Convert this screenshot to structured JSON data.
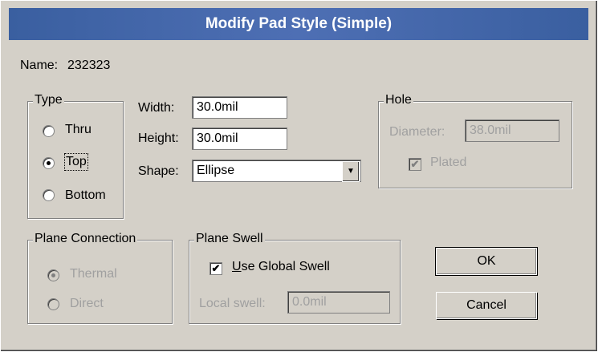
{
  "window": {
    "title": "Modify Pad Style (Simple)"
  },
  "name": {
    "label": "Name:",
    "value": "232323"
  },
  "type_group": {
    "title": "Type",
    "options": [
      {
        "label": "Thru",
        "selected": false
      },
      {
        "label": "Top",
        "selected": true
      },
      {
        "label": "Bottom",
        "selected": false
      }
    ]
  },
  "dimensions": {
    "width_label": "Width:",
    "width_value": "30.0mil",
    "height_label": "Height:",
    "height_value": "30.0mil",
    "shape_label": "Shape:",
    "shape_value": "Ellipse"
  },
  "hole_group": {
    "title": "Hole",
    "diameter_label": "Diameter:",
    "diameter_value": "38.0mil",
    "plated_label": "Plated",
    "plated_checked": true,
    "enabled": false
  },
  "plane_connection": {
    "title": "Plane Connection",
    "options": [
      {
        "label": "Thermal",
        "selected": true
      },
      {
        "label": "Direct",
        "selected": false
      }
    ],
    "enabled": false
  },
  "plane_swell": {
    "title": "Plane Swell",
    "use_global_label_first": "U",
    "use_global_label_rest": "se Global Swell",
    "use_global_checked": true,
    "local_swell_label": "Local swell:",
    "local_swell_value": "0.0mil"
  },
  "buttons": {
    "ok": "OK",
    "cancel": "Cancel"
  },
  "colors": {
    "titlebar": "#3a5fa0",
    "dialog_bg": "#d4d0c8",
    "disabled_text": "#a0a0a0"
  }
}
